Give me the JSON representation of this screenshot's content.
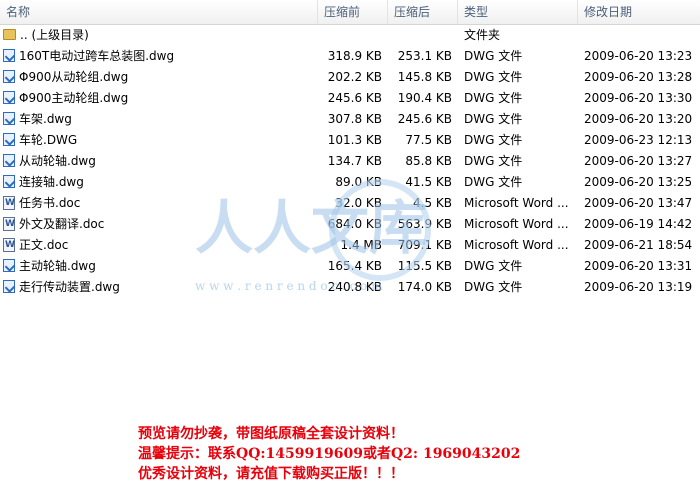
{
  "columns": {
    "name": "名称",
    "compressed": "压缩前",
    "size": "压缩后",
    "type": "类型",
    "modified": "修改日期"
  },
  "rows": [
    {
      "icon": "folder-icon",
      "name": ".. (上级目录)",
      "compressed": "",
      "size": "",
      "type": "文件夹",
      "modified": ""
    },
    {
      "icon": "dwg-file-icon",
      "name": "160T电动过跨车总装图.dwg",
      "compressed": "318.9 KB",
      "size": "253.1 KB",
      "type": "DWG 文件",
      "modified": "2009-06-20 13:23"
    },
    {
      "icon": "dwg-file-icon",
      "name": "Φ900从动轮组.dwg",
      "compressed": "202.2 KB",
      "size": "145.8 KB",
      "type": "DWG 文件",
      "modified": "2009-06-20 13:28"
    },
    {
      "icon": "dwg-file-icon",
      "name": "Φ900主动轮组.dwg",
      "compressed": "245.6 KB",
      "size": "190.4 KB",
      "type": "DWG 文件",
      "modified": "2009-06-20 13:30"
    },
    {
      "icon": "dwg-file-icon",
      "name": "车架.dwg",
      "compressed": "307.8 KB",
      "size": "245.6 KB",
      "type": "DWG 文件",
      "modified": "2009-06-20 13:20"
    },
    {
      "icon": "dwg-file-icon",
      "name": "车轮.DWG",
      "compressed": "101.3 KB",
      "size": "77.5 KB",
      "type": "DWG 文件",
      "modified": "2009-06-23 12:13"
    },
    {
      "icon": "dwg-file-icon",
      "name": "从动轮轴.dwg",
      "compressed": "134.7 KB",
      "size": "85.8 KB",
      "type": "DWG 文件",
      "modified": "2009-06-20 13:27"
    },
    {
      "icon": "dwg-file-icon",
      "name": "连接轴.dwg",
      "compressed": "89.0 KB",
      "size": "41.5 KB",
      "type": "DWG 文件",
      "modified": "2009-06-20 13:25"
    },
    {
      "icon": "doc-file-icon",
      "name": "任务书.doc",
      "compressed": "32.0 KB",
      "size": "4.5 KB",
      "type": "Microsoft Word ...",
      "modified": "2009-06-20 13:47"
    },
    {
      "icon": "doc-file-icon",
      "name": "外文及翻译.doc",
      "compressed": "684.0 KB",
      "size": "563.9 KB",
      "type": "Microsoft Word ...",
      "modified": "2009-06-19 14:42"
    },
    {
      "icon": "doc-file-icon",
      "name": "正文.doc",
      "compressed": "1.4 MB",
      "size": "709.1 KB",
      "type": "Microsoft Word ...",
      "modified": "2009-06-21 18:54"
    },
    {
      "icon": "dwg-file-icon",
      "name": "主动轮轴.dwg",
      "compressed": "165.4 KB",
      "size": "115.5 KB",
      "type": "DWG 文件",
      "modified": "2009-06-20 13:31"
    },
    {
      "icon": "dwg-file-icon",
      "name": "走行传动装置.dwg",
      "compressed": "240.8 KB",
      "size": "174.0 KB",
      "type": "DWG 文件",
      "modified": "2009-06-20 13:19"
    }
  ],
  "watermark": {
    "text": "人人文库",
    "url": "w w w . r e n r e n d o c . c o m"
  },
  "notice": {
    "line1": "预览请勿抄袭，带图纸原稿全套设计资料！",
    "line2": "温馨提示：联系QQ:1459919609或者Q2: 1969043202",
    "line3": "优秀设计资料，请充值下载购买正版！！！"
  },
  "colors": {
    "header_text": "#4c607a",
    "notice": "#e8000b",
    "watermark": "#9cc3e6"
  }
}
